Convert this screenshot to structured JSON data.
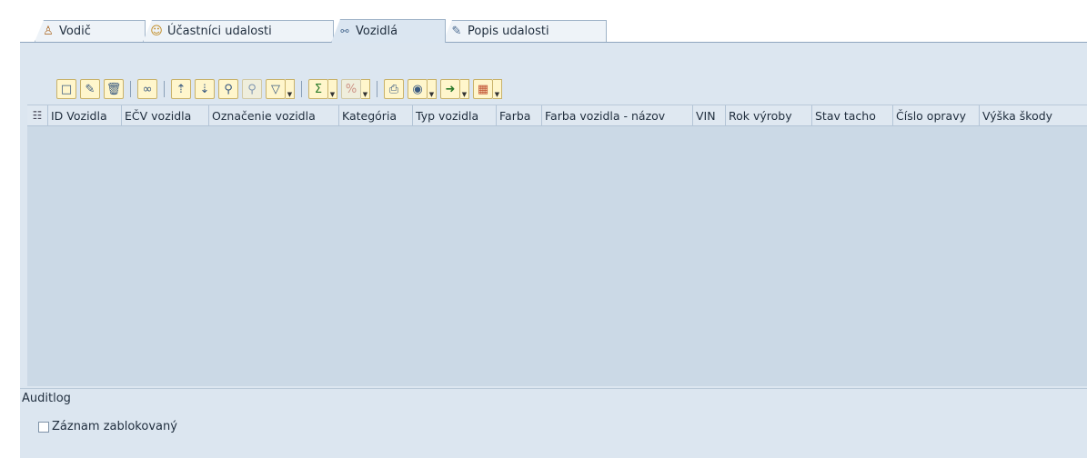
{
  "tabs": [
    {
      "label": "Vodič",
      "icon": "driver-icon",
      "active": false
    },
    {
      "label": "Účastníci udalosti",
      "icon": "people-icon",
      "active": false
    },
    {
      "label": "Vozidlá",
      "icon": "car-icon",
      "active": true
    },
    {
      "label": "Popis udalosti",
      "icon": "document-edit-icon",
      "active": false
    }
  ],
  "grid": {
    "columns": [
      "ID Vozidla",
      "EČV vozidla",
      "Označenie vozidla",
      "Kategória",
      "Typ vozidla",
      "Farba",
      "Farba vozidla - názov",
      "VIN",
      "Rok výroby",
      "Stav tacho",
      "Číslo opravy",
      "Výška škody"
    ]
  },
  "audit": {
    "title": "Auditlog",
    "checkbox_label": "Záznam zablokovaný",
    "checked": false
  },
  "colors": {
    "panel_bg": "#dce6f0",
    "grid_bg": "#cbd9e6",
    "toolbar_button": "#fff6cc"
  }
}
